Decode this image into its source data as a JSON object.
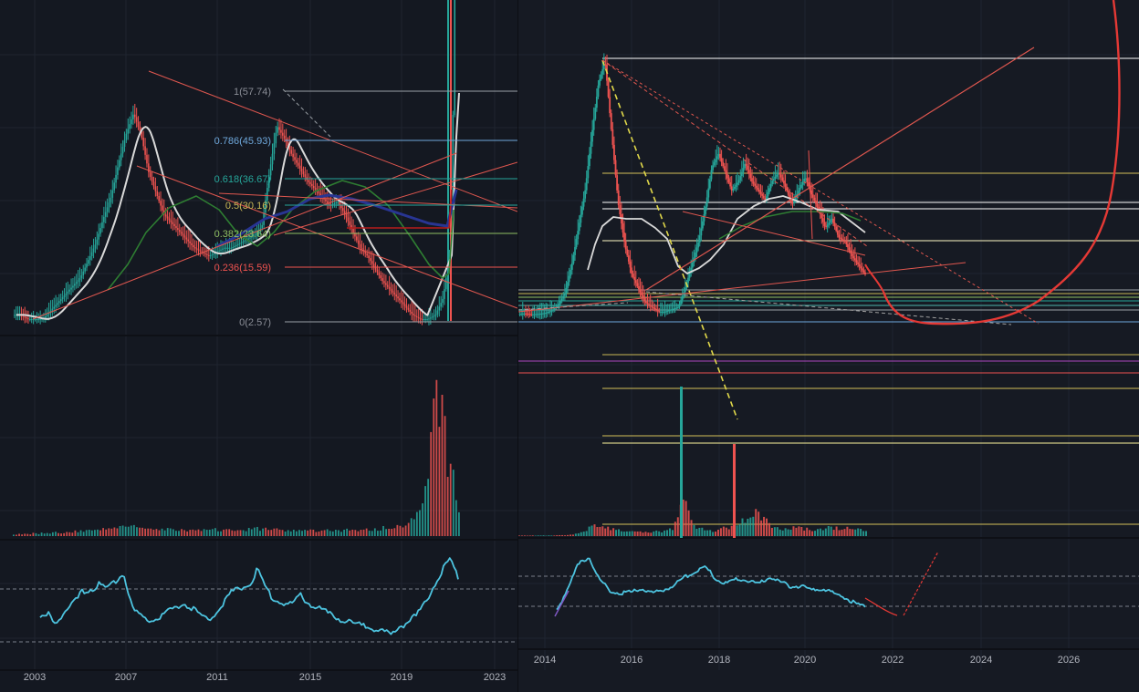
{
  "left_chart": {
    "fib_levels": [
      {
        "label": "1(57.74)",
        "color": "#8a8d96"
      },
      {
        "label": "0.786(45.93)",
        "color": "#6fa8dc"
      },
      {
        "label": "0.618(36.67)",
        "color": "#26a69a"
      },
      {
        "label": "0.5(30.16)",
        "color": "#c9b856"
      },
      {
        "label": "0.382(23.64)",
        "color": "#8fbf62"
      },
      {
        "label": "0.236(15.59)",
        "color": "#ef5350"
      },
      {
        "label": "0(2.57)",
        "color": "#8a8d96"
      }
    ],
    "x_ticks": [
      "2003",
      "2007",
      "2011",
      "2015",
      "2019",
      "2023"
    ]
  },
  "right_chart": {
    "x_ticks": [
      "2014",
      "2016",
      "2018",
      "2020",
      "2022",
      "2024",
      "2026"
    ]
  },
  "chart_data": [
    {
      "type": "line",
      "panel": "left",
      "x_ticks": [
        "2003",
        "2007",
        "2011",
        "2015",
        "2019",
        "2023"
      ],
      "fibonacci": [
        {
          "ratio": 1,
          "value": 57.74
        },
        {
          "ratio": 0.786,
          "value": 45.93
        },
        {
          "ratio": 0.618,
          "value": 36.67
        },
        {
          "ratio": 0.5,
          "value": 30.16
        },
        {
          "ratio": 0.382,
          "value": 23.64
        },
        {
          "ratio": 0.236,
          "value": 15.59
        },
        {
          "ratio": 0,
          "value": 2.57
        }
      ],
      "series": [
        {
          "values": [
            4,
            4,
            3,
            3,
            3,
            5,
            7,
            9,
            11,
            13,
            17,
            21,
            27,
            32,
            40,
            47,
            52,
            47,
            38,
            33,
            28,
            26,
            24,
            22,
            20,
            19,
            18,
            19,
            20,
            20,
            21,
            22,
            23,
            25,
            38,
            49,
            46,
            42,
            39,
            36,
            34,
            32,
            30,
            31,
            28,
            24,
            20,
            18,
            15,
            12,
            10,
            8,
            6,
            4,
            3,
            3,
            4,
            8,
            20,
            120
          ]
        },
        {
          "values": [
            0.3,
            0.35,
            0.28,
            0.38,
            0.45,
            0.55,
            0.58,
            0.62,
            0.58,
            0.66,
            0.74,
            0.4,
            0.33,
            0.3,
            0.32,
            0.37,
            0.4,
            0.45,
            0.42,
            0.36,
            0.3,
            0.36,
            0.47,
            0.56,
            0.6,
            0.62,
            0.76,
            0.58,
            0.49,
            0.46,
            0.44,
            0.53,
            0.46,
            0.42,
            0.38,
            0.33,
            0.3,
            0.28,
            0.26,
            0.24,
            0.22,
            0.2,
            0.16,
            0.24,
            0.28,
            0.34,
            0.44,
            0.6,
            0.74,
            0.86,
            0.7
          ]
        }
      ]
    },
    {
      "type": "line",
      "panel": "right",
      "x_ticks": [
        "2014",
        "2016",
        "2018",
        "2020",
        "2022",
        "2024",
        "2026"
      ],
      "series": [
        {
          "values": [
            1.5,
            1.6,
            1.4,
            1.5,
            1.7,
            2.2,
            3.5,
            6,
            12,
            20,
            28,
            40,
            51,
            56,
            40,
            25,
            16,
            10,
            7,
            4,
            3,
            2,
            2,
            2.5,
            3,
            7,
            12,
            17,
            24,
            33,
            36,
            32,
            28,
            30,
            34,
            30,
            28,
            26,
            30,
            32,
            29,
            25,
            28,
            31,
            27,
            24,
            20,
            22,
            18,
            17,
            14,
            12,
            10
          ]
        },
        {
          "values": [
            0.18,
            0.4,
            0.64,
            0.72,
            0.5,
            0.38,
            0.36,
            0.37,
            0.4,
            0.36,
            0.39,
            0.43,
            0.52,
            0.57,
            0.62,
            0.49,
            0.46,
            0.5,
            0.48,
            0.45,
            0.52,
            0.47,
            0.42,
            0.43,
            0.39,
            0.4,
            0.36,
            0.32,
            0.26,
            0.22
          ]
        }
      ]
    }
  ]
}
